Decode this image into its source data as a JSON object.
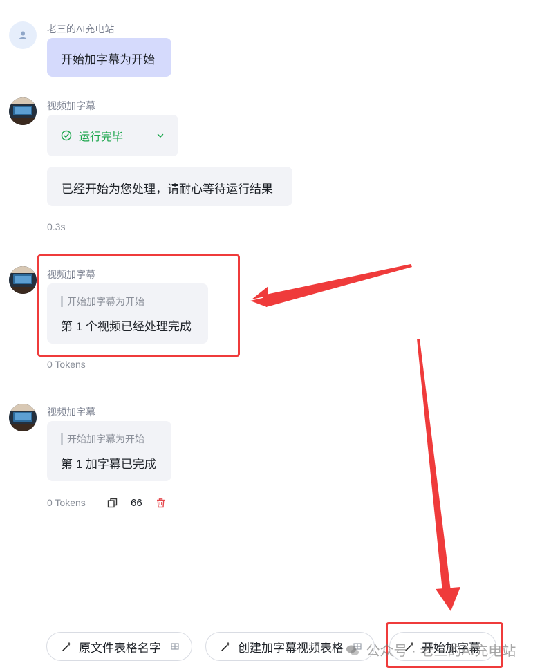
{
  "messages": {
    "user": {
      "name": "老三的AI充电站",
      "text": "开始加字幕为开始"
    },
    "bot1": {
      "name": "视频加字幕",
      "status_label": "运行完毕",
      "text": "已经开始为您处理，请耐心等待运行结果",
      "meta": "0.3s"
    },
    "bot2": {
      "name": "视频加字幕",
      "quote": "开始加字幕为开始",
      "text": "第 1 个视频已经处理完成",
      "meta": "0 Tokens"
    },
    "bot3": {
      "name": "视频加字幕",
      "quote": "开始加字幕为开始",
      "text": "第 1 加字幕已完成",
      "meta": "0 Tokens",
      "quote_count": "66"
    }
  },
  "suggestions": [
    {
      "label": "原文件表格名字"
    },
    {
      "label": "创建加字幕视频表格"
    },
    {
      "label": "开始加字幕"
    }
  ],
  "watermark": "公众号 · 老三的AI充电站",
  "colors": {
    "user_bubble": "#d5dafc",
    "bot_bubble": "#f2f3f7",
    "success": "#1aa54b",
    "annotation": "#ef3b3b",
    "delete": "#e5484d"
  }
}
